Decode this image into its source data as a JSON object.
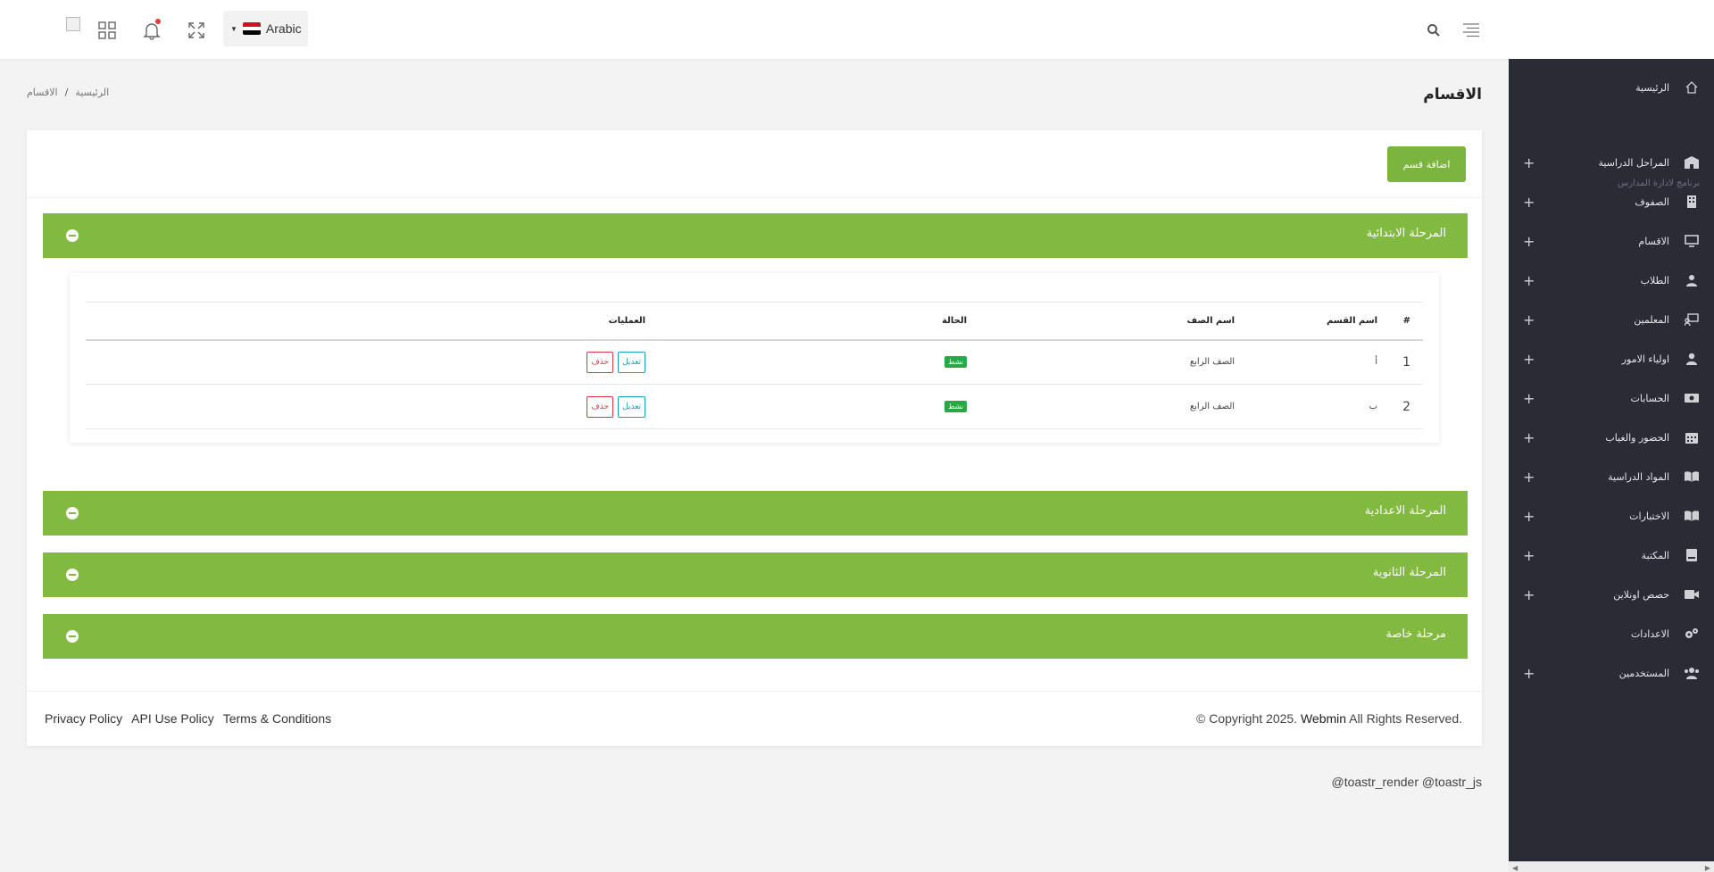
{
  "header": {
    "language": "Arabic",
    "icons": [
      "broken-image-icon",
      "apps-grid-icon",
      "bell-icon",
      "fullscreen-icon",
      "search-icon",
      "menu-icon"
    ],
    "flag_colors": [
      "#ce1126",
      "#ffffff",
      "#000000"
    ]
  },
  "sidebar": {
    "home": "الرئيسية",
    "caption": "برنامج لادارة المدارس",
    "items": [
      {
        "label": "المراحل الدراسية",
        "icon": "school-icon"
      },
      {
        "label": "الصفوف",
        "icon": "building-icon"
      },
      {
        "label": "الاقسام",
        "icon": "monitor-icon"
      },
      {
        "label": "الطلاب",
        "icon": "student-icon"
      },
      {
        "label": "المعلمين",
        "icon": "teacher-icon"
      },
      {
        "label": "اولياء الامور",
        "icon": "user-icon"
      },
      {
        "label": "الحسابات",
        "icon": "money-icon"
      },
      {
        "label": "الحضور والغياب",
        "icon": "calendar-icon"
      },
      {
        "label": "المواد الدراسية",
        "icon": "book-open-icon"
      },
      {
        "label": "الاختبارات",
        "icon": "book-icon"
      },
      {
        "label": "المكتبة",
        "icon": "library-icon"
      },
      {
        "label": "حصص اونلاين",
        "icon": "video-icon"
      },
      {
        "label": "الاعدادات",
        "icon": "gears-icon"
      },
      {
        "label": "المستخدمين",
        "icon": "users-icon"
      }
    ],
    "plus": "+"
  },
  "page": {
    "title": "الاقسام",
    "breadcrumb": [
      "الرئيسية",
      "/",
      "الاقسام"
    ]
  },
  "main": {
    "add_button": "اضافة قسم",
    "stages": [
      {
        "title": "المرحلة الابتدائية"
      },
      {
        "title": "المرحلة الاعدادية"
      },
      {
        "title": "المرحلة الثانوية"
      },
      {
        "title": "مرحلة خاصة"
      }
    ],
    "table": {
      "headers": [
        "#",
        "اسم القسم",
        "اسم الصف",
        "الحالة",
        "العمليات"
      ],
      "rows": [
        {
          "num": "1",
          "section": "أ",
          "grade": "الصف الرابع",
          "status": "نشط",
          "edit": "تعديل",
          "delete": "حذف"
        },
        {
          "num": "2",
          "section": "ب",
          "grade": "الصف الرابع",
          "status": "نشط",
          "edit": "تعديل",
          "delete": "حذف"
        }
      ]
    }
  },
  "footer": {
    "links": [
      "Privacy Policy",
      "API Use Policy",
      "Terms & Conditions"
    ],
    "copyright_pre": "© Copyright 2025. ",
    "brand": "Webmin",
    "copyright_post": " All Rights Reserved."
  },
  "toastr_text": "@toastr_render @toastr_js",
  "colors": {
    "accent_green": "#82b941",
    "sidebar_bg": "#2a2b35"
  }
}
